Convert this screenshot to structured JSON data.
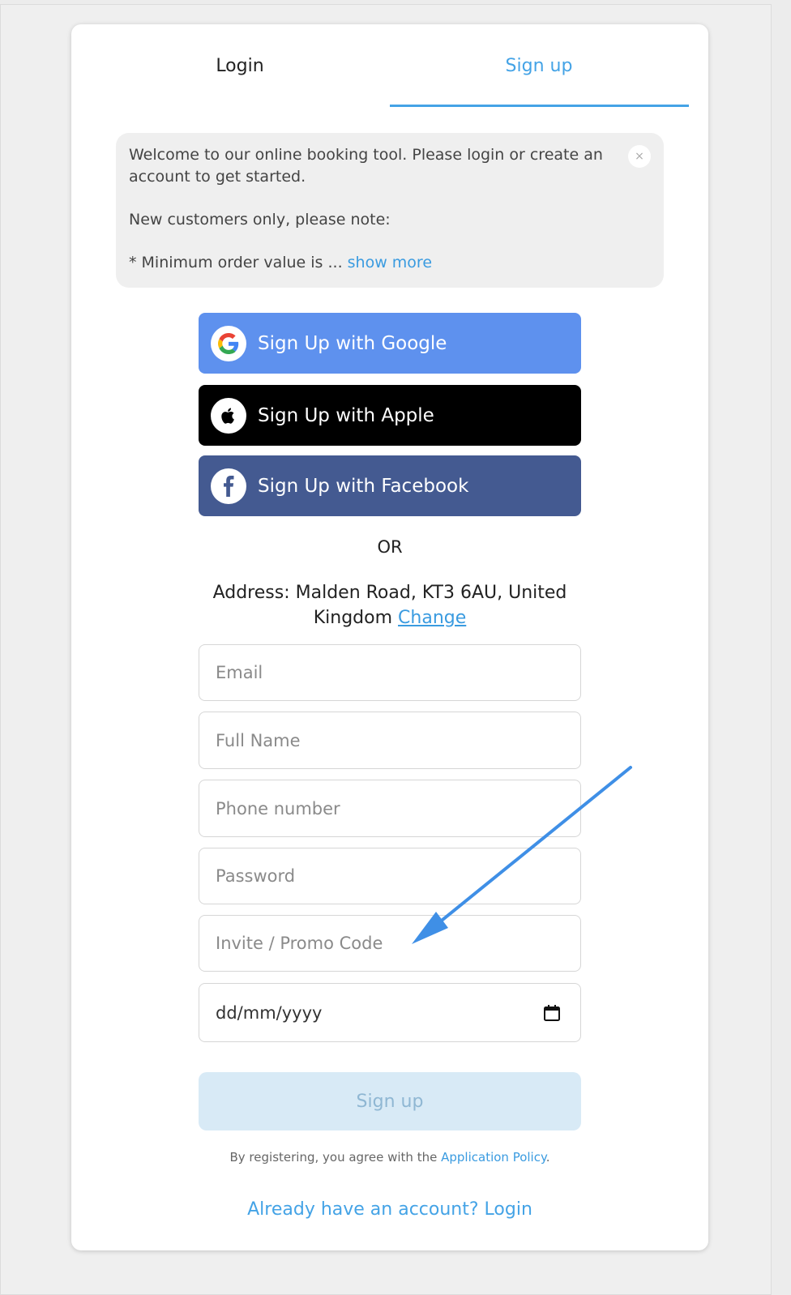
{
  "tabs": {
    "login_label": "Login",
    "signup_label": "Sign up",
    "active": "Sign up"
  },
  "notice": {
    "line1": "Welcome to our online booking tool. Please login or create an account to get started.",
    "line2": "New customers only, please note:",
    "line3": "* Minimum order value is ...",
    "show_more": "show more",
    "close_glyph": "×"
  },
  "social": {
    "google_label": "Sign Up with Google",
    "apple_label": "Sign Up with Apple",
    "facebook_label": "Sign Up with Facebook"
  },
  "or_label": "OR",
  "address": {
    "text": "Address: Malden Road, KT3 6AU, United Kingdom",
    "change_label": "Change"
  },
  "form": {
    "email_placeholder": "Email",
    "name_placeholder": "Full Name",
    "phone_placeholder": "Phone number",
    "password_placeholder": "Password",
    "promo_placeholder": "Invite / Promo Code",
    "date_placeholder": "dd/mm/yyyy",
    "submit_label": "Sign up"
  },
  "footer": {
    "policy_prefix": "By registering, you agree with the",
    "policy_link": "Application Policy",
    "policy_suffix": ".",
    "already_label": "Already have an account? Login"
  },
  "colors": {
    "accent": "#44a3e6",
    "google": "#5e91ee",
    "apple": "#000000",
    "facebook": "#445a91",
    "submit_disabled": "#d8eaf6",
    "annotation_arrow": "#3f8fe6"
  },
  "icons": {
    "google": "google-icon",
    "apple": "apple-icon",
    "facebook": "facebook-icon",
    "calendar": "calendar-icon",
    "close": "close-icon"
  }
}
